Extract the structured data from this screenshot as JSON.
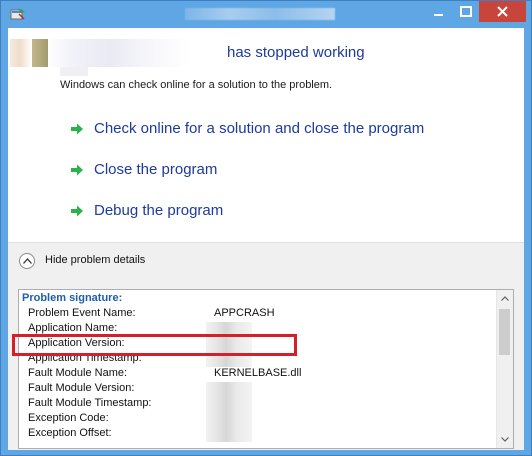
{
  "window": {
    "title": "",
    "buttons": {
      "minimize": "minimize",
      "maximize": "maximize",
      "close": "close"
    }
  },
  "header": {
    "title_suffix": "has stopped working",
    "subtitle": "Windows can check online for a solution to the problem."
  },
  "commands": [
    {
      "label": "Check online for a solution and close the program",
      "icon": "green-arrow-icon"
    },
    {
      "label": "Close the program",
      "icon": "green-arrow-icon"
    },
    {
      "label": "Debug the program",
      "icon": "green-arrow-icon"
    }
  ],
  "details_toggle": {
    "label": "Hide problem details",
    "icon": "chevron-up-circle-icon"
  },
  "problem_signature": {
    "heading": "Problem signature:",
    "rows": [
      {
        "key": "Problem Event Name:",
        "value": "APPCRASH"
      },
      {
        "key": "Application Name:",
        "value": ""
      },
      {
        "key": "Application Version:",
        "value": ""
      },
      {
        "key": "Application Timestamp:",
        "value": ""
      },
      {
        "key": "Fault Module Name:",
        "value": "KERNELBASE.dll"
      },
      {
        "key": "Fault Module Version:",
        "value": ""
      },
      {
        "key": "Fault Module Timestamp:",
        "value": ""
      },
      {
        "key": "Exception Code:",
        "value": ""
      },
      {
        "key": "Exception Offset:",
        "value": ""
      }
    ]
  },
  "colors": {
    "link": "#1e3a9c",
    "highlight": "#d4202a",
    "titlebar": "#5ea7e4",
    "close_button": "#c7453a",
    "arrow": "#2cb24a"
  }
}
